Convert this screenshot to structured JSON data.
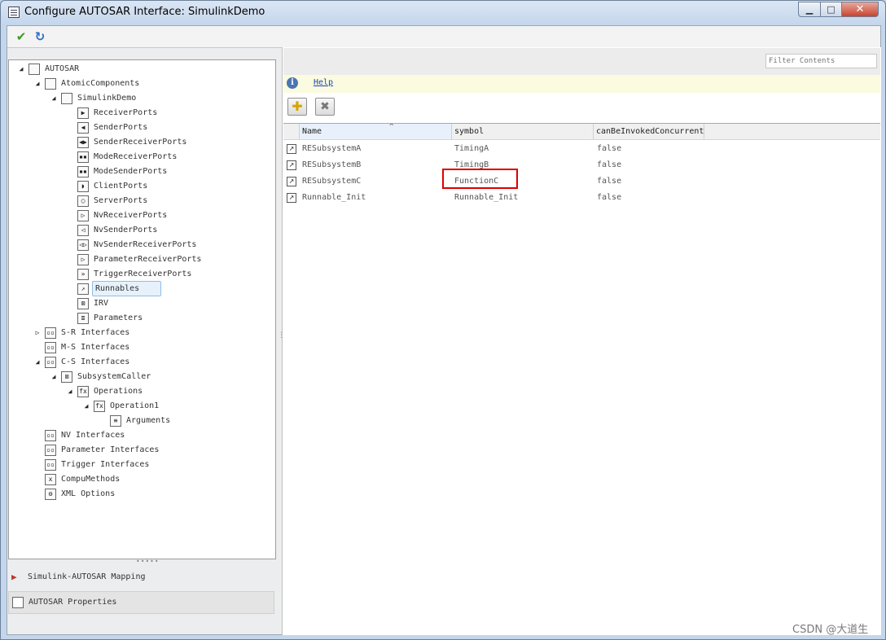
{
  "window": {
    "title": "Configure AUTOSAR Interface: SimulinkDemo",
    "min_glyph": "▁",
    "max_glyph": "□",
    "close_glyph": "✕"
  },
  "toolbar": {
    "apply_glyph": "✔",
    "refresh_glyph": "↻"
  },
  "tree": {
    "nodes": [
      {
        "label": "AUTOSAR",
        "toggle": "◢",
        "icon": "grid-icon",
        "icon_glyph": ""
      },
      {
        "label": "AtomicComponents",
        "toggle": "◢",
        "icon": "components-icon",
        "icon_glyph": ""
      },
      {
        "label": "SimulinkDemo",
        "toggle": "◢",
        "icon": "component-icon",
        "icon_glyph": ""
      },
      {
        "label": "ReceiverPorts",
        "toggle": "",
        "icon": "receiver-port-icon",
        "icon_glyph": "▶"
      },
      {
        "label": "SenderPorts",
        "toggle": "",
        "icon": "sender-port-icon",
        "icon_glyph": "◀"
      },
      {
        "label": "SenderReceiverPorts",
        "toggle": "",
        "icon": "sender-receiver-port-icon",
        "icon_glyph": "◀▶"
      },
      {
        "label": "ModeReceiverPorts",
        "toggle": "",
        "icon": "mode-receiver-port-icon",
        "icon_glyph": "▪▪"
      },
      {
        "label": "ModeSenderPorts",
        "toggle": "",
        "icon": "mode-sender-port-icon",
        "icon_glyph": "▪▪"
      },
      {
        "label": "ClientPorts",
        "toggle": "",
        "icon": "client-port-icon",
        "icon_glyph": "◗"
      },
      {
        "label": "ServerPorts",
        "toggle": "",
        "icon": "server-port-icon",
        "icon_glyph": "○"
      },
      {
        "label": "NvReceiverPorts",
        "toggle": "",
        "icon": "nv-receiver-port-icon",
        "icon_glyph": "▷"
      },
      {
        "label": "NvSenderPorts",
        "toggle": "",
        "icon": "nv-sender-port-icon",
        "icon_glyph": "◁"
      },
      {
        "label": "NvSenderReceiverPorts",
        "toggle": "",
        "icon": "nv-sender-receiver-port-icon",
        "icon_glyph": "◁▷"
      },
      {
        "label": "ParameterReceiverPorts",
        "toggle": "",
        "icon": "parameter-receiver-port-icon",
        "icon_glyph": "▷"
      },
      {
        "label": "TriggerReceiverPorts",
        "toggle": "",
        "icon": "trigger-receiver-port-icon",
        "icon_glyph": "»"
      },
      {
        "label": "Runnables",
        "toggle": "",
        "icon": "runnable-icon",
        "icon_glyph": "↗"
      },
      {
        "label": "IRV",
        "toggle": "",
        "icon": "irv-icon",
        "icon_glyph": "⊠"
      },
      {
        "label": "Parameters",
        "toggle": "",
        "icon": "parameters-icon",
        "icon_glyph": "≣"
      },
      {
        "label": "S-R Interfaces",
        "toggle": "▷",
        "icon": "interfaces-icon",
        "icon_glyph": "▫▫"
      },
      {
        "label": "M-S Interfaces",
        "toggle": "",
        "icon": "interfaces-icon",
        "icon_glyph": "▫▫"
      },
      {
        "label": "C-S Interfaces",
        "toggle": "◢",
        "icon": "interfaces-icon",
        "icon_glyph": "▫▫"
      },
      {
        "label": "SubsystemCaller",
        "toggle": "◢",
        "icon": "interface-icon",
        "icon_glyph": "⊠"
      },
      {
        "label": "Operations",
        "toggle": "◢",
        "icon": "fx-icon",
        "icon_glyph": "fx"
      },
      {
        "label": "Operation1",
        "toggle": "◢",
        "icon": "fx-icon",
        "icon_glyph": "fx"
      },
      {
        "label": "Arguments",
        "toggle": "",
        "icon": "arguments-icon",
        "icon_glyph": "≡"
      },
      {
        "label": "NV Interfaces",
        "toggle": "",
        "icon": "interfaces-icon",
        "icon_glyph": "▫▫"
      },
      {
        "label": "Parameter Interfaces",
        "toggle": "",
        "icon": "interfaces-icon",
        "icon_glyph": "▫▫"
      },
      {
        "label": "Trigger Interfaces",
        "toggle": "",
        "icon": "interfaces-icon",
        "icon_glyph": "▫▫"
      },
      {
        "label": "CompuMethods",
        "toggle": "",
        "icon": "compu-method-icon",
        "icon_glyph": "x"
      },
      {
        "label": "XML Options",
        "toggle": "",
        "icon": "gear-icon",
        "icon_glyph": "⚙"
      }
    ],
    "selected": "Runnables"
  },
  "bottom_nav": {
    "splitter_glyph": "•••••",
    "items": [
      {
        "label": "Simulink-AUTOSAR Mapping",
        "icon": "mapping-icon"
      },
      {
        "label": "AUTOSAR Properties",
        "icon": "grid-icon"
      }
    ]
  },
  "filter": {
    "placeholder": "Filter Contents"
  },
  "help": {
    "icon_glyph": "i",
    "link": "Help"
  },
  "actions": {
    "add_glyph": "✚",
    "delete_glyph": "✖"
  },
  "table": {
    "columns": [
      "Name",
      "symbol",
      "canBeInvokedConcurrently"
    ],
    "sort_glyph": "^",
    "row_icon_glyph": "↗",
    "rows": [
      {
        "name": "RESubsystemA",
        "symbol": "TimingA",
        "concurrent": "false"
      },
      {
        "name": "RESubsystemB",
        "symbol": "TimingB",
        "concurrent": "false"
      },
      {
        "name": "RESubsystemC",
        "symbol": "FunctionC",
        "concurrent": "false"
      },
      {
        "name": "Runnable_Init",
        "symbol": "Runnable_Init",
        "concurrent": "false"
      }
    ],
    "highlighted_cell": "FunctionC"
  },
  "watermark": "CSDN @大道生"
}
